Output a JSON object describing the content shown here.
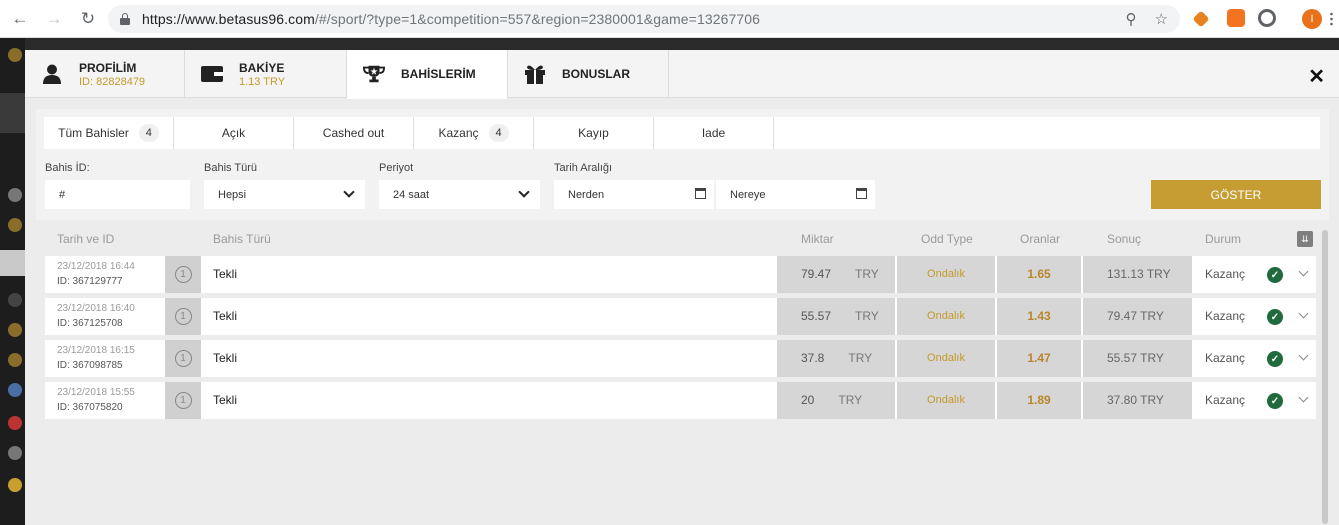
{
  "browser": {
    "url_main": "https://www.betasus96.com",
    "url_rest": "/#/sport/?type=1&competition=557&region=2380001&game=13267706",
    "avatar_letter": "I"
  },
  "tabs": [
    {
      "title": "PROFİLİM",
      "sub": "ID: 82828479"
    },
    {
      "title": "BAKİYE",
      "sub": "1.13 TRY"
    },
    {
      "title": "BAHİSLERİM",
      "sub": ""
    },
    {
      "title": "BONUSLAR",
      "sub": ""
    }
  ],
  "filters": {
    "all": {
      "label": "Tüm Bahisler",
      "count": "4"
    },
    "open": "Açık",
    "cashed": "Cashed out",
    "won": {
      "label": "Kazanç",
      "count": "4"
    },
    "lost": "Kayıp",
    "refund": "Iade"
  },
  "form": {
    "bet_id_label": "Bahis İD:",
    "bet_id_value": "#",
    "bet_type_label": "Bahis Türü",
    "bet_type_value": "Hepsi",
    "period_label": "Periyot",
    "period_value": "24 saat",
    "range_label": "Tarih Aralığı",
    "from_value": "Nerden",
    "to_value": "Nereye",
    "show_button": "GÖSTER"
  },
  "table": {
    "headers": {
      "date": "Tarih ve ID",
      "type": "Bahis Türü",
      "amount": "Miktar",
      "odd_type": "Odd Type",
      "rates": "Oranlar",
      "result": "Sonuç",
      "status": "Durum"
    },
    "rows": [
      {
        "date": "23/12/2018 16:44",
        "id": "ID: 367129777",
        "num": "1",
        "type": "Tekli",
        "amount": "79.47",
        "currency": "TRY",
        "odd_type": "Ondalık",
        "rate": "1.65",
        "result": "131.13 TRY",
        "status": "Kazanç"
      },
      {
        "date": "23/12/2018 16:40",
        "id": "ID: 367125708",
        "num": "1",
        "type": "Tekli",
        "amount": "55.57",
        "currency": "TRY",
        "odd_type": "Ondalık",
        "rate": "1.43",
        "result": "79.47 TRY",
        "status": "Kazanç"
      },
      {
        "date": "23/12/2018 16:15",
        "id": "ID: 367098785",
        "num": "1",
        "type": "Tekli",
        "amount": "37.8",
        "currency": "TRY",
        "odd_type": "Ondalık",
        "rate": "1.47",
        "result": "55.57 TRY",
        "status": "Kazanç"
      },
      {
        "date": "23/12/2018 15:55",
        "id": "ID: 367075820",
        "num": "1",
        "type": "Tekli",
        "amount": "20",
        "currency": "TRY",
        "odd_type": "Ondalık",
        "rate": "1.89",
        "result": "37.80 TRY",
        "status": "Kazanç"
      }
    ]
  },
  "colors": {
    "accent": "#c59d32",
    "status_ok": "#1f6b3d"
  }
}
